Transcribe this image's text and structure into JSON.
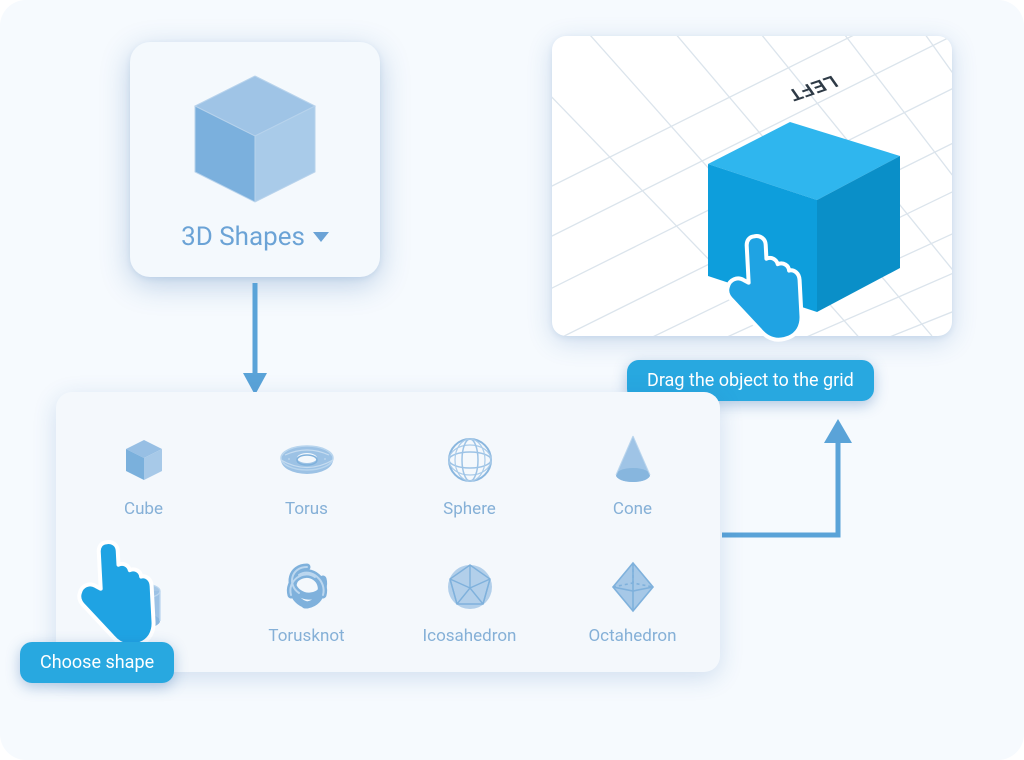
{
  "shapesButton": {
    "label": "3D Shapes"
  },
  "viewport": {
    "axisLabel": "LEFT"
  },
  "palette": {
    "items": [
      {
        "label": "Cube"
      },
      {
        "label": "Torus"
      },
      {
        "label": "Sphere"
      },
      {
        "label": "Cone"
      },
      {
        "label": ""
      },
      {
        "label": "Torusknot"
      },
      {
        "label": "Icosahedron"
      },
      {
        "label": "Octahedron"
      }
    ]
  },
  "bubbles": {
    "drag": "Drag the object to the grid",
    "choose": "Choose shape"
  },
  "colors": {
    "accent": "#28a8e0",
    "softBlue": "#88b6de",
    "text": "#6ba3d6"
  }
}
